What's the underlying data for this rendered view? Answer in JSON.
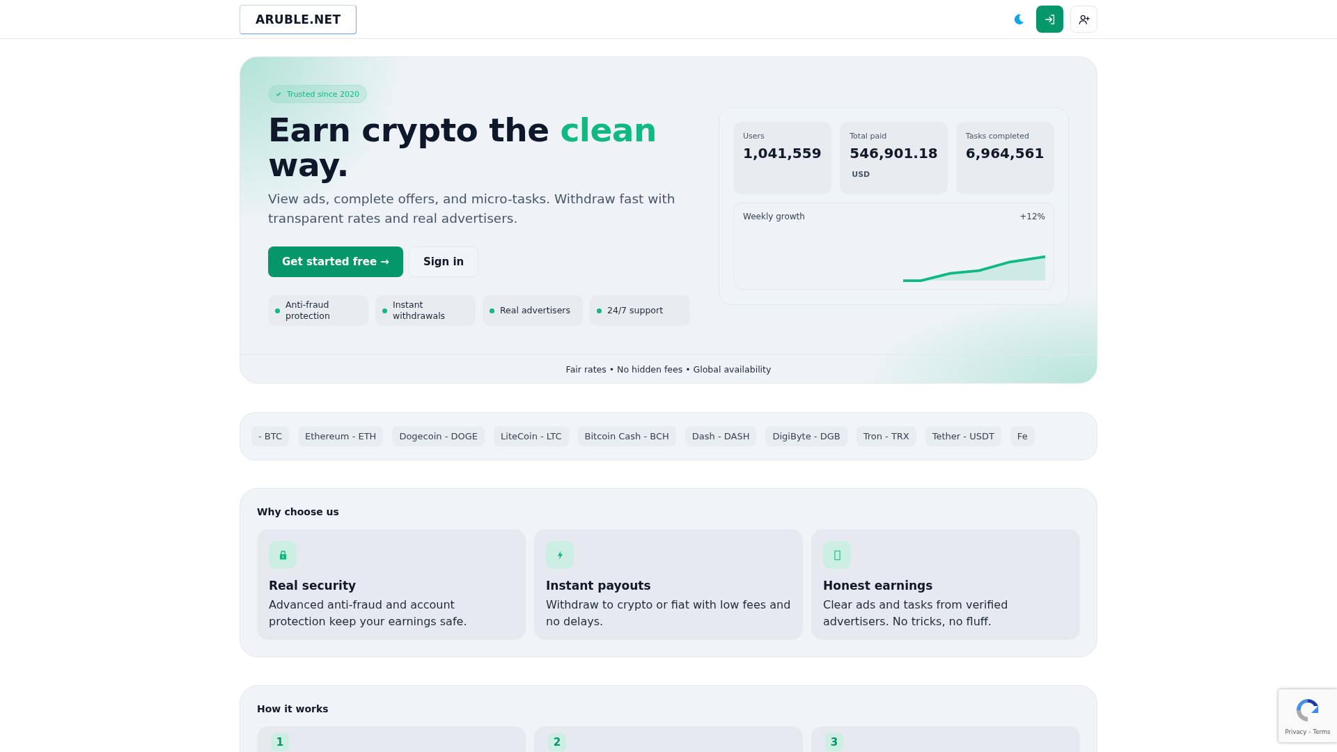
{
  "header": {
    "logo": "ARUBLE.NET"
  },
  "hero": {
    "badge": "Trusted since 2020",
    "title_lead": "Earn crypto the",
    "title_highlight": "clean",
    "title_tail": "way.",
    "description": "View ads, complete offers, and micro-tasks. Withdraw fast with transparent rates and real advertisers.",
    "buttons": [
      {
        "label": "Get started free →",
        "kind": "primary"
      },
      {
        "label": "Sign in",
        "kind": "secondary"
      }
    ],
    "features": [
      {
        "label": "Anti-fraud protection"
      },
      {
        "label": "Instant withdrawals"
      },
      {
        "label": "Real advertisers"
      },
      {
        "label": "24/7 support"
      }
    ],
    "stats": [
      {
        "label": "Users",
        "value": "1,041,559"
      },
      {
        "label": "Total paid",
        "value": "546,901.18",
        "unit": "USD"
      },
      {
        "label": "Tasks completed",
        "value": "6,964,561"
      }
    ],
    "growth": {
      "label": "Weekly growth",
      "change": "+12%"
    },
    "footer_note": "Fair rates • No hidden fees • Global availability"
  },
  "coins": [
    "- BTC",
    "Ethereum - ETH",
    "Dogecoin - DOGE",
    "LiteCoin - LTC",
    "Bitcoin Cash - BCH",
    "Dash - DASH",
    "DigiByte - DGB",
    "Tron - TRX",
    "Tether - USDT",
    "Fe"
  ],
  "why": {
    "title": "Why choose us",
    "cards": [
      {
        "kind": "lock",
        "title": "Real security",
        "text": "Advanced anti-fraud and account protection keep your earnings safe."
      },
      {
        "kind": "bolt",
        "title": "Instant payouts",
        "text": "Withdraw to crypto or fiat with low fees and no delays."
      },
      {
        "kind": "box",
        "title": "Honest earnings",
        "text": "Clear ads and tasks from verified advertisers. No tricks, no fluff."
      }
    ]
  },
  "how": {
    "title": "How it works",
    "steps": [
      "1",
      "2",
      "3"
    ]
  },
  "recaptcha": {
    "links": [
      "Privacy",
      "Terms"
    ],
    "separator": "-"
  }
}
